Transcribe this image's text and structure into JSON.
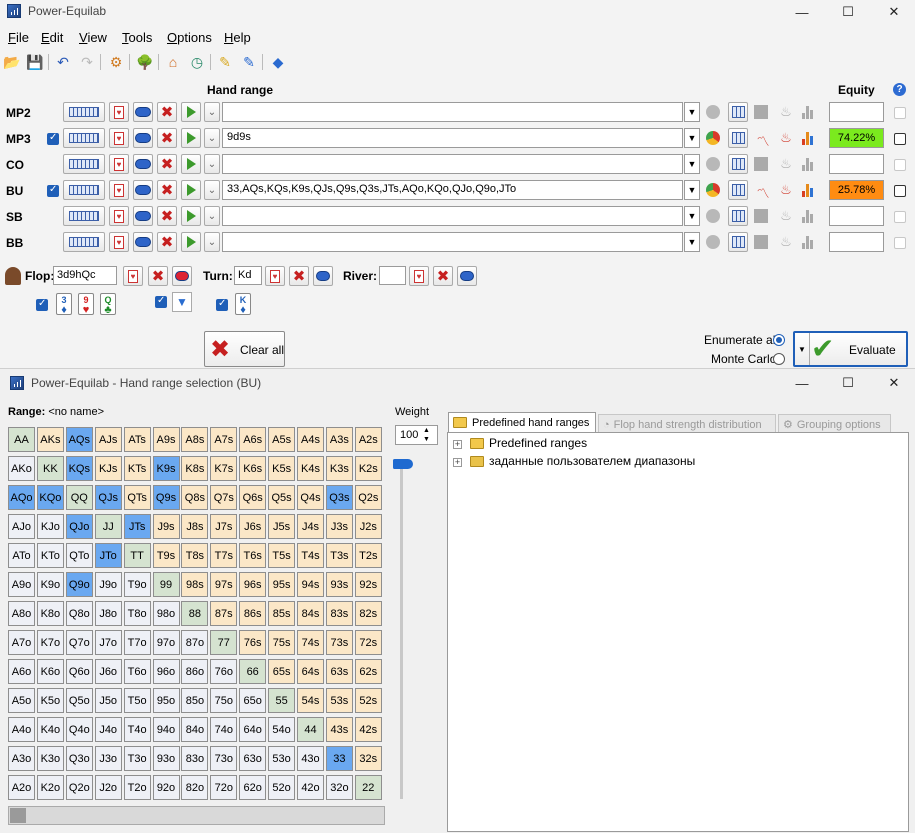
{
  "main": {
    "title": "Power-Equilab",
    "menu": [
      "File",
      "Edit",
      "View",
      "Tools",
      "Options",
      "Help"
    ],
    "menu_underline": [
      "F",
      "E",
      "V",
      "T",
      "O",
      "H"
    ],
    "headers": {
      "hand_range": "Hand range",
      "equity": "Equity",
      "help": "?"
    },
    "players": [
      {
        "pos": "MP2",
        "checked": false,
        "range": "",
        "equity": "",
        "active": false
      },
      {
        "pos": "MP3",
        "checked": true,
        "range": "9d9s",
        "equity": "74.22%",
        "active": true,
        "equity_color": "#7bea1e"
      },
      {
        "pos": "CO",
        "checked": false,
        "range": "",
        "equity": "",
        "active": false
      },
      {
        "pos": "BU",
        "checked": true,
        "range": "33,AQs,KQs,K9s,QJs,Q9s,Q3s,JTs,AQo,KQo,QJo,Q9o,JTo",
        "equity": "25.78%",
        "active": true,
        "equity_color": "#ff8c12"
      },
      {
        "pos": "SB",
        "checked": false,
        "range": "",
        "equity": "",
        "active": false
      },
      {
        "pos": "BB",
        "checked": false,
        "range": "",
        "equity": "",
        "active": false
      }
    ],
    "board": {
      "flop_label": "Flop:",
      "flop_value": "3d9hQc",
      "turn_label": "Turn:",
      "turn_value": "Kd",
      "river_label": "River:",
      "river_value": "",
      "flop_cards": [
        {
          "rank": "3",
          "suit": "♦",
          "color": "#1f5fb8"
        },
        {
          "rank": "9",
          "suit": "♥",
          "color": "#d42020"
        },
        {
          "rank": "Q",
          "suit": "♣",
          "color": "#1e8c2a"
        }
      ],
      "turn_card": {
        "rank": "K",
        "suit": "♦",
        "color": "#1f5fb8"
      }
    },
    "clear_all": "Clear all",
    "enumerate_all": "Enumerate all",
    "monte_carlo": "Monte Carlo",
    "evaluate": "Evaluate"
  },
  "range_window": {
    "title": "Power-Equilab - Hand range selection (BU)",
    "range_label": "Range:",
    "range_name": "<no name>",
    "weight_label": "Weight",
    "weight_value": "100",
    "tabs": [
      "Predefined hand ranges",
      "Flop hand strength distribution",
      "Grouping options"
    ],
    "tree": [
      "Predefined ranges",
      "заданные пользователем диапазоны"
    ],
    "ranks": [
      "A",
      "K",
      "Q",
      "J",
      "T",
      "9",
      "8",
      "7",
      "6",
      "5",
      "4",
      "3",
      "2"
    ],
    "selected_hands": [
      "AQs",
      "KQs",
      "K9s",
      "QJs",
      "Q9s",
      "Q3s",
      "JTs",
      "AQo",
      "KQo",
      "QJo",
      "Q9o",
      "JTo",
      "33"
    ],
    "colors": {
      "pair": "#d5e3d0",
      "suited": "#fbe7c7",
      "offsuit": "#eef0f6",
      "selected": "#6aa8f0"
    }
  }
}
